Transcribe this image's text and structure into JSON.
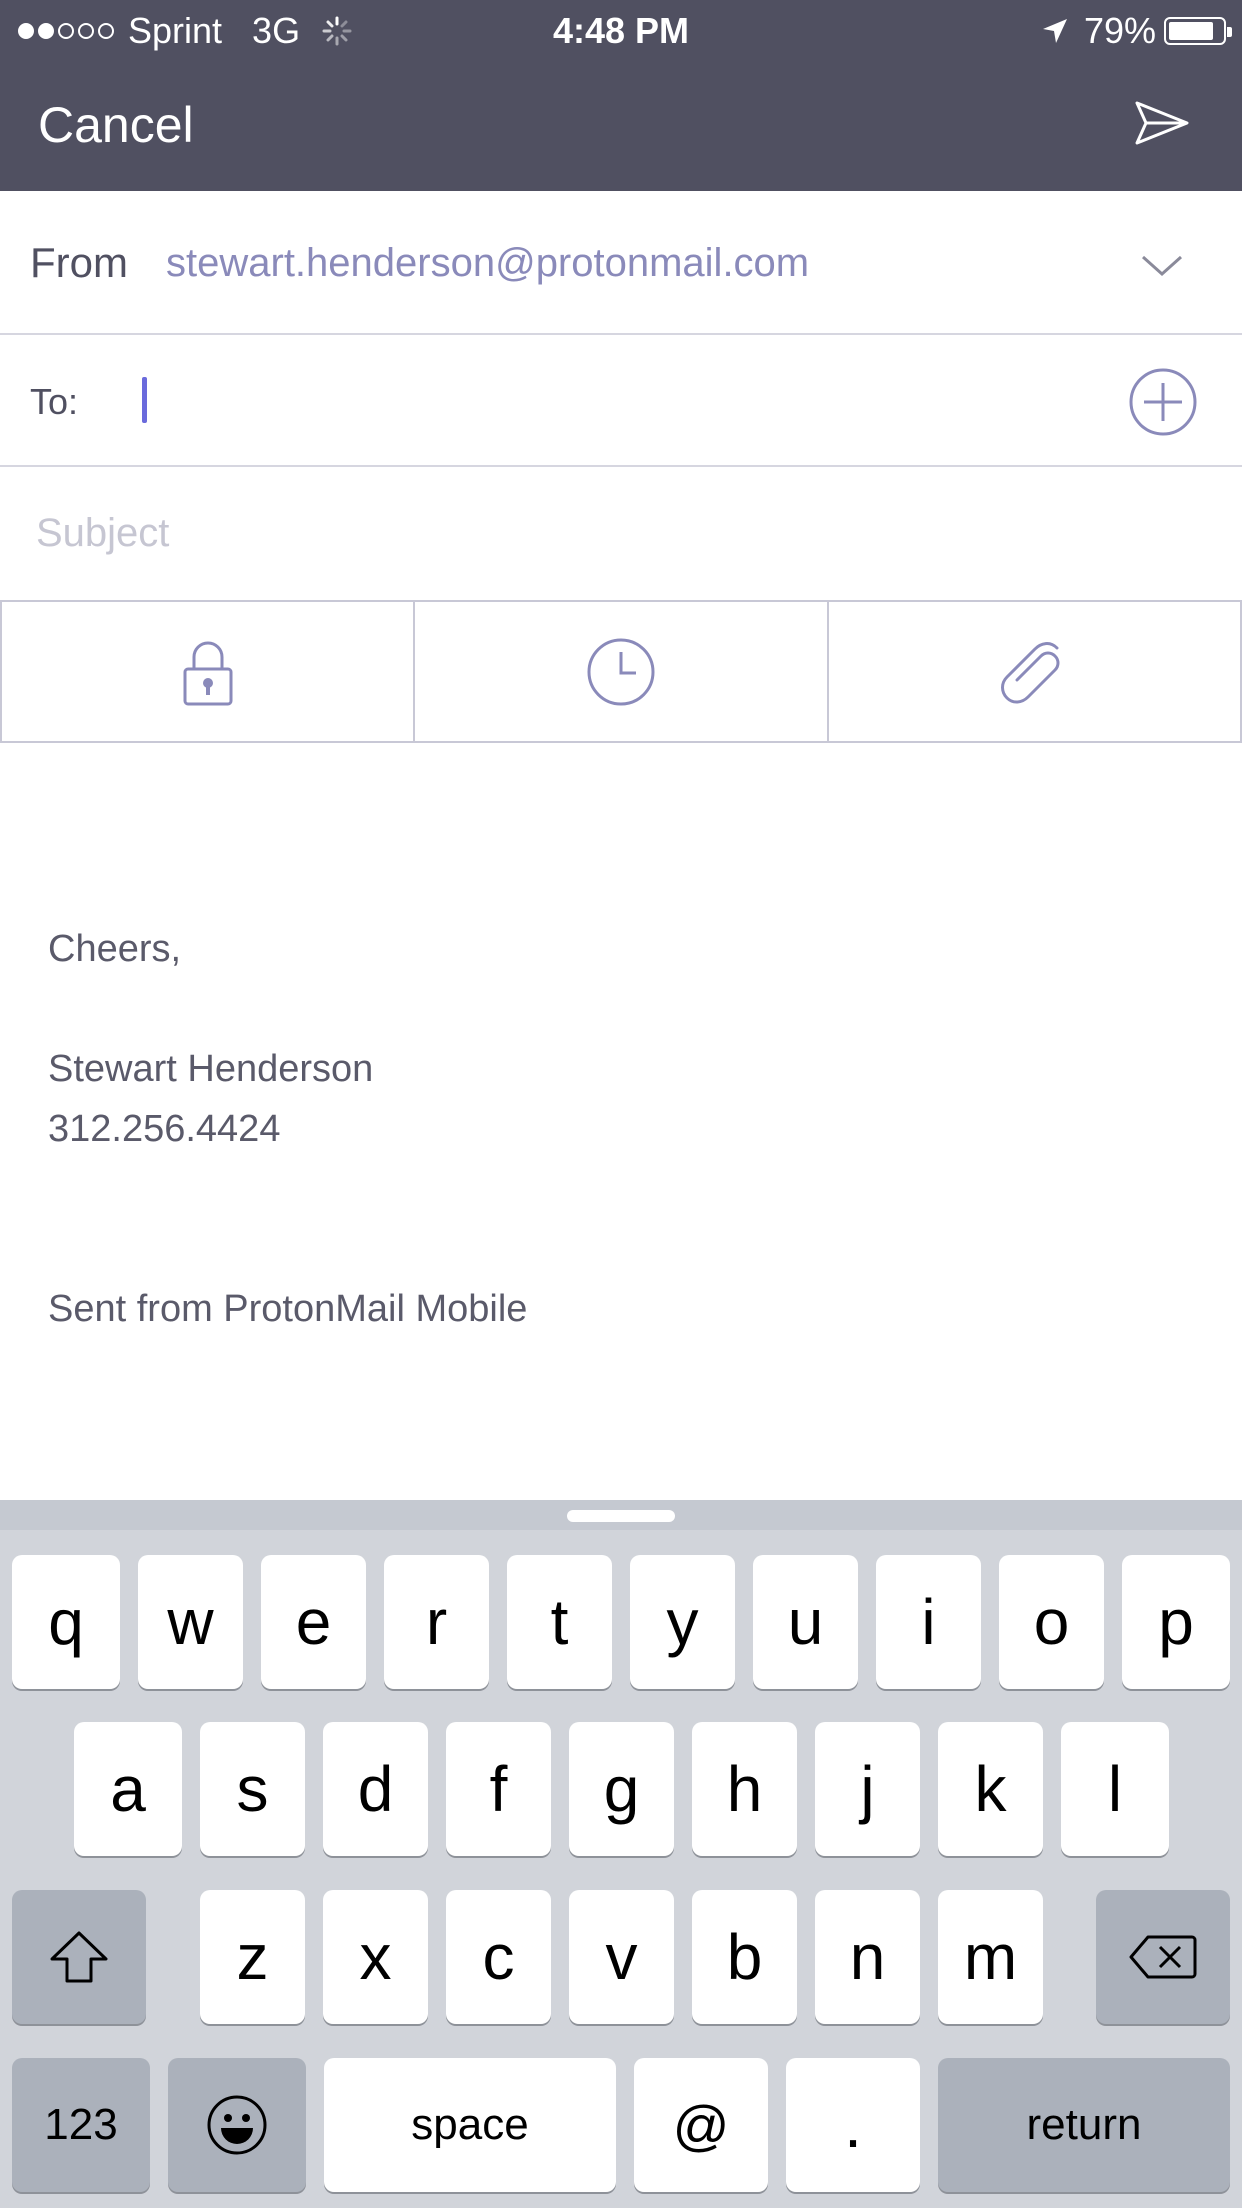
{
  "status_bar": {
    "carrier": "Sprint",
    "network": "3G",
    "time": "4:48 PM",
    "battery": "79%"
  },
  "nav": {
    "cancel_label": "Cancel",
    "send_icon": "send-icon"
  },
  "compose": {
    "from_label": "From",
    "from_value": "stewart.henderson@protonmail.com",
    "to_label": "To:",
    "to_value": "",
    "subject_placeholder": "Subject"
  },
  "options": {
    "icons": [
      "lock-icon",
      "clock-icon",
      "paperclip-icon"
    ]
  },
  "body": {
    "line1": "Cheers,",
    "name": "Stewart Henderson",
    "phone": "312.256.4424",
    "signature": "Sent from ProtonMail Mobile"
  },
  "keyboard": {
    "row1": [
      "q",
      "w",
      "e",
      "r",
      "t",
      "y",
      "u",
      "i",
      "o",
      "p"
    ],
    "row2": [
      "a",
      "s",
      "d",
      "f",
      "g",
      "h",
      "j",
      "k",
      "l"
    ],
    "row3": [
      "z",
      "x",
      "c",
      "v",
      "b",
      "n",
      "m"
    ],
    "numbers_label": "123",
    "space_label": "space",
    "at_label": "@",
    "dot_label": ".",
    "return_label": "return"
  },
  "colors": {
    "header": "#505061",
    "accent": "#8a8aba",
    "caret": "#6a6adc"
  }
}
